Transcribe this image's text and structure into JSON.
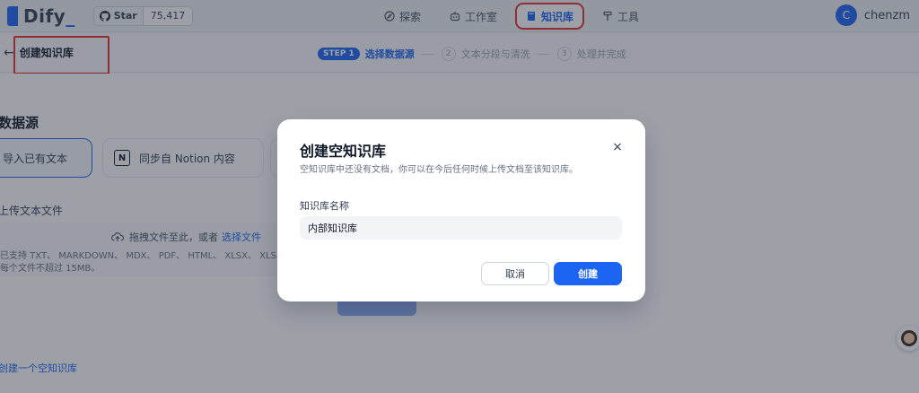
{
  "app": {
    "logo": "Dify",
    "github": {
      "star_label": "Star",
      "star_count": "75,417"
    }
  },
  "nav": {
    "items": [
      {
        "label": "探索",
        "icon": "compass-icon"
      },
      {
        "label": "工作室",
        "icon": "robot-icon"
      },
      {
        "label": "知识库",
        "icon": "book-icon"
      },
      {
        "label": "工具",
        "icon": "hammer-icon"
      }
    ],
    "active_index": 2
  },
  "user": {
    "initial": "C",
    "name": "chenzm"
  },
  "page": {
    "back_arrow": "←",
    "title": "创建知识库"
  },
  "steps": {
    "step1_badge": "STEP 1",
    "step1_label": "选择数据源",
    "step2_num": "2",
    "step2_label": "文本分段与清洗",
    "step3_num": "3",
    "step3_label": "处理并完成"
  },
  "content": {
    "datasource_title": "数据源",
    "source_import": "导入已有文本",
    "source_notion": "同步自 Notion 内容",
    "upload_title": "上传文本文件",
    "drop_text": "拖拽文件至此，或者",
    "drop_link": "选择文件",
    "drop_hint1": "已支持 TXT、 MARKDOWN、 MDX、 PDF、 HTML、 XLSX、 XLS、 DOCX、",
    "drop_hint2": "每个文件不超过 15MB。",
    "empty_link": "创建一个空知识库"
  },
  "modal": {
    "title": "创建空知识库",
    "close_glyph": "×",
    "description": "空知识库中还没有文档，你可以在今后任何时候上传文档至该知识库。",
    "field_label": "知识库名称",
    "field_value": "内部知识库",
    "cancel_label": "取消",
    "create_label": "创建"
  },
  "colors": {
    "accent": "#1c64f2",
    "highlight_box": "#e5322d"
  }
}
